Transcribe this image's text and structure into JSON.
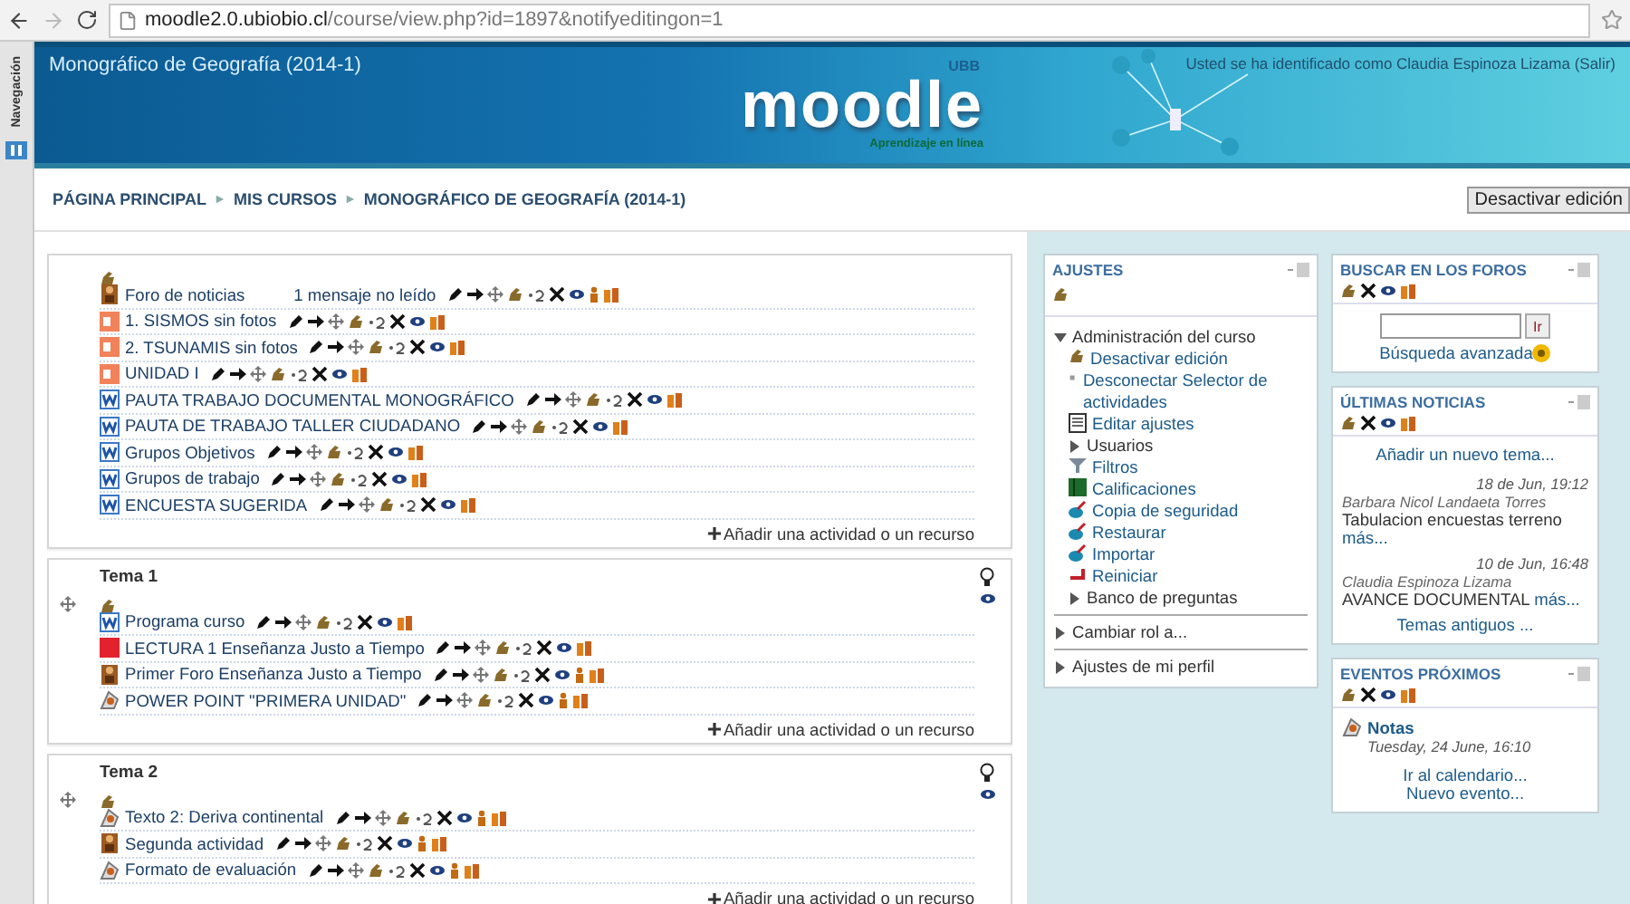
{
  "browser": {
    "url_host": "moodle2.0.ubiobio.cl",
    "url_path": "/course/view.php?id=1897&notifyeditingon=1"
  },
  "nav_tab": {
    "label": "Navegación"
  },
  "header": {
    "course_title": "Monográfico de Geografía (2014-1)",
    "logo": "moodle",
    "logo_suffix": "UBB",
    "tagline": "Aprendizaje en línea",
    "login_text": "Usted se ha identificado como Claudia Espinoza Lizama",
    "logout_link": "(Salir)"
  },
  "breadcrumb": {
    "separator": "►",
    "items": [
      "PÁGINA PRINCIPAL",
      "MIS CURSOS",
      "MONOGRÁFICO DE GEOGRAFÍA (2014-1)"
    ]
  },
  "edit_button": "Desactivar edición",
  "sections": [
    {
      "activities": [
        {
          "kind": "forum",
          "name": "Foro de noticias",
          "note": "1 mensaje no leído",
          "person_icon": true
        },
        {
          "kind": "pdf",
          "name": "1. SISMOS sin fotos",
          "person_icon": false
        },
        {
          "kind": "pdf",
          "name": "2. TSUNAMIS sin fotos",
          "person_icon": false
        },
        {
          "kind": "pdf",
          "name": "UNIDAD I",
          "person_icon": false
        },
        {
          "kind": "word",
          "name": "PAUTA TRABAJO DOCUMENTAL MONOGRÁFICO",
          "person_icon": false
        },
        {
          "kind": "word",
          "name": "PAUTA DE TRABAJO TALLER CIUDADANO",
          "person_icon": false
        },
        {
          "kind": "word",
          "name": "Grupos Objetivos",
          "person_icon": false
        },
        {
          "kind": "word",
          "name": "Grupos de trabajo",
          "person_icon": false
        },
        {
          "kind": "word",
          "name": "ENCUESTA SUGERIDA",
          "person_icon": false
        }
      ],
      "add_link": "Añadir una actividad o un recurso"
    },
    {
      "title": "Tema 1",
      "activities": [
        {
          "kind": "word",
          "name": "Programa curso",
          "person_icon": false
        },
        {
          "kind": "file",
          "name": "LECTURA 1 Enseñanza Justo a Tiempo",
          "person_icon": false
        },
        {
          "kind": "forum",
          "name": "Primer Foro Enseñanza Justo a Tiempo",
          "person_icon": true
        },
        {
          "kind": "page",
          "name": "POWER POINT \"PRIMERA UNIDAD\"",
          "person_icon": true
        }
      ],
      "add_link": "Añadir una actividad o un recurso"
    },
    {
      "title": "Tema 2",
      "activities": [
        {
          "kind": "page",
          "name": "Texto 2: Deriva continental",
          "person_icon": true
        },
        {
          "kind": "forum",
          "name": "Segunda actividad",
          "person_icon": true
        },
        {
          "kind": "page",
          "name": "Formato de evaluación",
          "person_icon": true
        }
      ],
      "add_link": "Añadir una actividad o un recurso"
    }
  ],
  "settings_block": {
    "title": "AJUSTES",
    "items": [
      {
        "label": "Administración del curso",
        "kind": "branch",
        "expanded": true,
        "children": [
          {
            "label": "Desactivar edición",
            "kind": "edit"
          },
          {
            "label": "Desconectar Selector de actividades",
            "kind": "bullet"
          },
          {
            "label": "Editar ajustes",
            "kind": "document"
          },
          {
            "label": "Usuarios",
            "kind": "branch",
            "expanded": false
          },
          {
            "label": "Filtros",
            "kind": "filter"
          },
          {
            "label": "Calificaciones",
            "kind": "grades"
          },
          {
            "label": "Copia de seguridad",
            "kind": "backup"
          },
          {
            "label": "Restaurar",
            "kind": "backup"
          },
          {
            "label": "Importar",
            "kind": "backup"
          },
          {
            "label": "Reiniciar",
            "kind": "reset"
          },
          {
            "label": "Banco de preguntas",
            "kind": "branch",
            "expanded": false
          }
        ]
      },
      {
        "label": "Cambiar rol a...",
        "kind": "branch",
        "expanded": false
      },
      {
        "label": "Ajustes de mi perfil",
        "kind": "branch",
        "expanded": false
      }
    ]
  },
  "search_block": {
    "title": "BUSCAR EN LOS FOROS",
    "button": "Ir",
    "advanced_link": "Búsqueda avanzada"
  },
  "news_block": {
    "title": "ÚLTIMAS NOTICIAS",
    "add_link": "Añadir un nuevo tema...",
    "posts": [
      {
        "date": "18 de Jun, 19:12",
        "author": "Barbara Nicol Landaeta Torres",
        "text": "Tabulacion encuestas terreno",
        "more": "más..."
      },
      {
        "date": "10 de Jun, 16:48",
        "author": "Claudia Espinoza Lizama",
        "text": "AVANCE DOCUMENTAL",
        "more": "más..."
      }
    ],
    "older_link": "Temas antiguos ..."
  },
  "events_block": {
    "title": "EVENTOS PRÓXIMOS",
    "event": {
      "name": "Notas",
      "date": "Tuesday, 24 June, 16:10"
    },
    "links": [
      "Ir al calendario...",
      "Nuevo evento..."
    ]
  }
}
